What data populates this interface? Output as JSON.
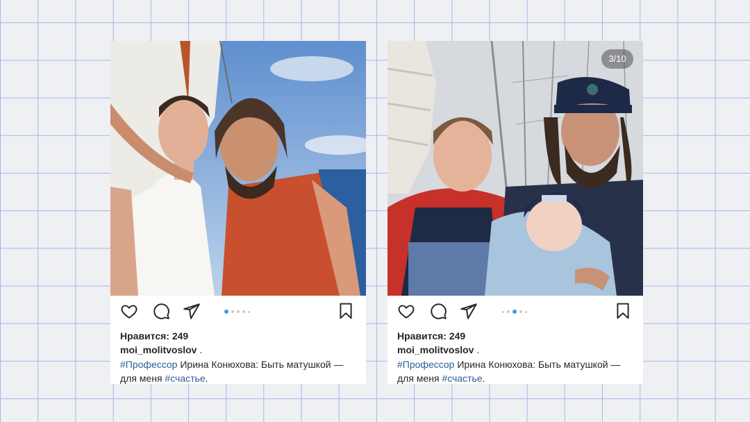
{
  "posts": [
    {
      "likes_text": "Нравится: 249",
      "username": "moi_molitvoslov",
      "username_suffix": " .",
      "caption_hashtag": "#Профессор",
      "caption_text": " Ирина Конюхова: Быть матушкой — для меня ",
      "caption_hashtag2": "#счастье",
      "caption_end": ".",
      "active_slide": 1,
      "total_slides": 5,
      "image_description": "woman in white top and bearded man in red vest on sailboat by the sea"
    },
    {
      "counter": "3/10",
      "likes_text": "Нравится: 249",
      "username": "moi_molitvoslov",
      "username_suffix": " .",
      "caption_hashtag": "#Профессор",
      "caption_text": " Ирина Конюхова: Быть матушкой — для меня ",
      "caption_hashtag2": "#счастье",
      "caption_end": ".",
      "active_slide": 3,
      "total_slides": 5,
      "image_description": "woman in red jacket, bearded man in captain cap holding baby on yacht deck"
    }
  ],
  "icons": {
    "like": "heart-icon",
    "comment": "comment-bubble-icon",
    "share": "paper-plane-icon",
    "save": "bookmark-icon"
  },
  "colors": {
    "hashtag": "#2d5d9a",
    "active_dot": "#3897f0",
    "grid_line": "#aab4e8",
    "background": "#eef0f4"
  }
}
